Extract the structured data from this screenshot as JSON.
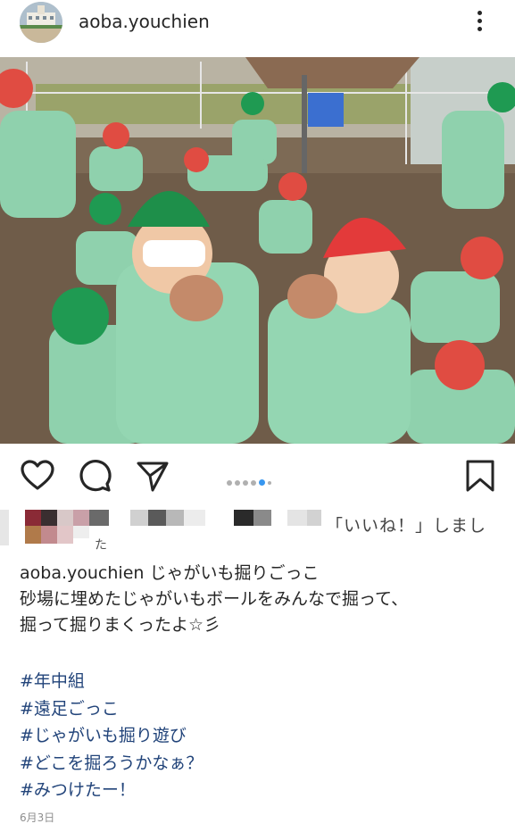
{
  "post": {
    "username": "aoba.youchien",
    "likes_text": "「いいね！」しまし",
    "likes_tail": "た",
    "caption_username": "aoba.youchien",
    "caption_title": " じゃがいも掘りごっこ",
    "caption_lines": [
      "砂場に埋めたじゃがいもボールをみんなで掘って、",
      "掘って掘りまくったよ☆彡"
    ],
    "hashtags": [
      "#年中組",
      "#遠足ごっこ",
      "#じゃがいも掘り遊び",
      "#どこを掘ろうかなぁ？",
      "#みつけたー！"
    ],
    "date": "6月3日"
  },
  "icons": {
    "avatar": "school-building-avatar",
    "more": "more-vertical-icon",
    "like": "heart-icon",
    "comment": "comment-bubble-icon",
    "share": "paper-plane-icon",
    "save": "bookmark-icon"
  },
  "carousel": {
    "count": 6,
    "active_index": 4
  },
  "colors": {
    "hashtag": "#22447a",
    "active_dot": "#3897f0",
    "text": "#262626"
  }
}
